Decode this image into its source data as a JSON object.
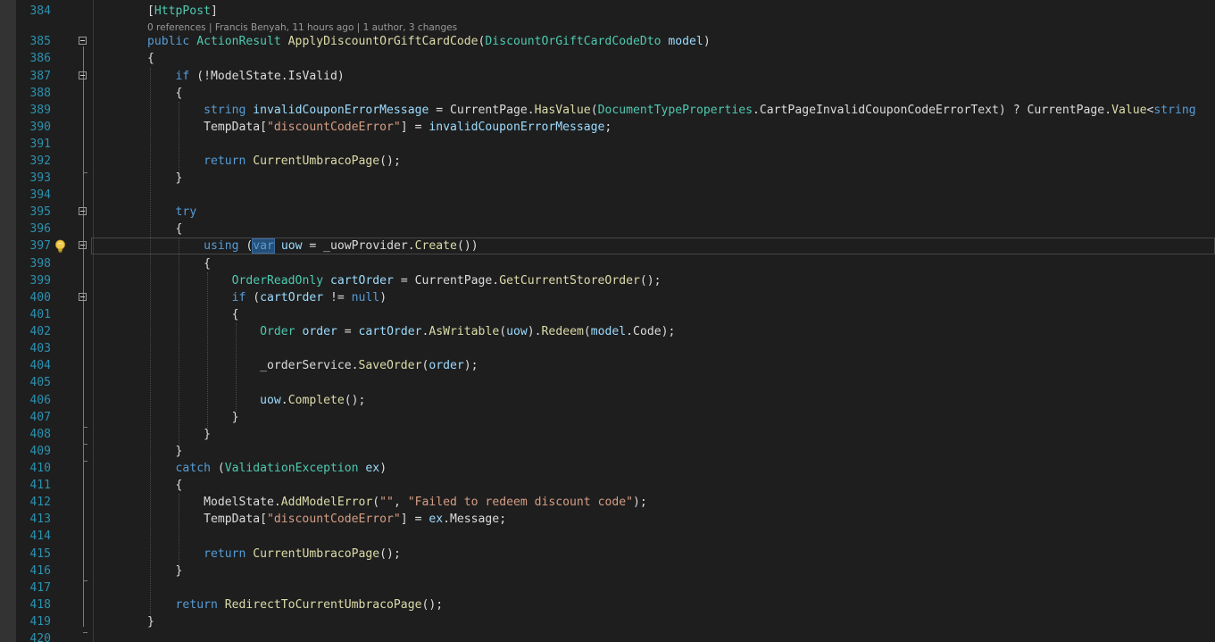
{
  "editor": {
    "codelens": "0 references | Francis Benyah, 11 hours ago | 1 author, 3 changes",
    "lines": [
      {
        "num": "384",
        "tokens": [
          {
            "t": "[",
            "c": "pl"
          },
          {
            "t": "HttpPost",
            "c": "ty"
          },
          {
            "t": "]",
            "c": "pl"
          }
        ]
      },
      {
        "num": "385",
        "tokens": [
          {
            "t": "public ",
            "c": "kw"
          },
          {
            "t": "ActionResult ",
            "c": "ty"
          },
          {
            "t": "ApplyDiscountOrGiftCardCode",
            "c": "fn"
          },
          {
            "t": "(",
            "c": "pl"
          },
          {
            "t": "DiscountOrGiftCardCodeDto ",
            "c": "ty"
          },
          {
            "t": "model",
            "c": "var"
          },
          {
            "t": ")",
            "c": "pl"
          }
        ]
      },
      {
        "num": "386",
        "tokens": [
          {
            "t": "{",
            "c": "pl"
          }
        ]
      },
      {
        "num": "387",
        "tokens": [
          {
            "t": "    ",
            "c": "pl"
          },
          {
            "t": "if ",
            "c": "kw"
          },
          {
            "t": "(!ModelState.IsValid)",
            "c": "pl"
          }
        ]
      },
      {
        "num": "388",
        "tokens": [
          {
            "t": "    {",
            "c": "pl"
          }
        ]
      },
      {
        "num": "389",
        "tokens": [
          {
            "t": "        ",
            "c": "pl"
          },
          {
            "t": "string ",
            "c": "kw"
          },
          {
            "t": "invalidCouponErrorMessage",
            "c": "var"
          },
          {
            "t": " = ",
            "c": "pl"
          },
          {
            "t": "CurrentPage",
            "c": "pl"
          },
          {
            "t": ".",
            "c": "pl"
          },
          {
            "t": "HasValue",
            "c": "fn"
          },
          {
            "t": "(",
            "c": "pl"
          },
          {
            "t": "DocumentTypeProperties",
            "c": "ty"
          },
          {
            "t": ".CartPageInvalidCouponCodeErrorText) ? ",
            "c": "pl"
          },
          {
            "t": "CurrentPage",
            "c": "pl"
          },
          {
            "t": ".",
            "c": "pl"
          },
          {
            "t": "Value",
            "c": "fn"
          },
          {
            "t": "<",
            "c": "pl"
          },
          {
            "t": "string",
            "c": "kw"
          }
        ]
      },
      {
        "num": "390",
        "tokens": [
          {
            "t": "        TempData[",
            "c": "pl"
          },
          {
            "t": "\"discountCodeError\"",
            "c": "str"
          },
          {
            "t": "] = ",
            "c": "pl"
          },
          {
            "t": "invalidCouponErrorMessage",
            "c": "var"
          },
          {
            "t": ";",
            "c": "pl"
          }
        ]
      },
      {
        "num": "391",
        "tokens": []
      },
      {
        "num": "392",
        "tokens": [
          {
            "t": "        ",
            "c": "pl"
          },
          {
            "t": "return ",
            "c": "kw"
          },
          {
            "t": "CurrentUmbracoPage",
            "c": "fn"
          },
          {
            "t": "();",
            "c": "pl"
          }
        ]
      },
      {
        "num": "393",
        "tokens": [
          {
            "t": "    }",
            "c": "pl"
          }
        ]
      },
      {
        "num": "394",
        "tokens": []
      },
      {
        "num": "395",
        "tokens": [
          {
            "t": "    ",
            "c": "pl"
          },
          {
            "t": "try",
            "c": "kw"
          }
        ]
      },
      {
        "num": "396",
        "tokens": [
          {
            "t": "    {",
            "c": "pl"
          }
        ]
      },
      {
        "num": "397",
        "tokens": [
          {
            "t": "        ",
            "c": "pl"
          },
          {
            "t": "using ",
            "c": "kw"
          },
          {
            "t": "(",
            "c": "pl"
          },
          {
            "t": "var",
            "c": "kw sel-var"
          },
          {
            "t": " ",
            "c": "pl"
          },
          {
            "t": "uow",
            "c": "var"
          },
          {
            "t": " = _uowProvider.",
            "c": "pl"
          },
          {
            "t": "Create",
            "c": "fn"
          },
          {
            "t": "())",
            "c": "pl"
          }
        ]
      },
      {
        "num": "398",
        "tokens": [
          {
            "t": "        {",
            "c": "pl"
          }
        ]
      },
      {
        "num": "399",
        "tokens": [
          {
            "t": "            ",
            "c": "pl"
          },
          {
            "t": "OrderReadOnly ",
            "c": "ty"
          },
          {
            "t": "cartOrder",
            "c": "var"
          },
          {
            "t": " = CurrentPage.",
            "c": "pl"
          },
          {
            "t": "GetCurrentStoreOrder",
            "c": "fn"
          },
          {
            "t": "();",
            "c": "pl"
          }
        ]
      },
      {
        "num": "400",
        "tokens": [
          {
            "t": "            ",
            "c": "pl"
          },
          {
            "t": "if ",
            "c": "kw"
          },
          {
            "t": "(",
            "c": "pl"
          },
          {
            "t": "cartOrder",
            "c": "var"
          },
          {
            "t": " != ",
            "c": "pl"
          },
          {
            "t": "null",
            "c": "kw"
          },
          {
            "t": ")",
            "c": "pl"
          }
        ]
      },
      {
        "num": "401",
        "tokens": [
          {
            "t": "            {",
            "c": "pl"
          }
        ]
      },
      {
        "num": "402",
        "tokens": [
          {
            "t": "                ",
            "c": "pl"
          },
          {
            "t": "Order ",
            "c": "ty"
          },
          {
            "t": "order",
            "c": "var"
          },
          {
            "t": " = ",
            "c": "pl"
          },
          {
            "t": "cartOrder",
            "c": "var"
          },
          {
            "t": ".",
            "c": "pl"
          },
          {
            "t": "AsWritable",
            "c": "fn"
          },
          {
            "t": "(",
            "c": "pl"
          },
          {
            "t": "uow",
            "c": "var"
          },
          {
            "t": ").",
            "c": "pl"
          },
          {
            "t": "Redeem",
            "c": "fn"
          },
          {
            "t": "(",
            "c": "pl"
          },
          {
            "t": "model",
            "c": "var"
          },
          {
            "t": ".Code);",
            "c": "pl"
          }
        ]
      },
      {
        "num": "403",
        "tokens": []
      },
      {
        "num": "404",
        "tokens": [
          {
            "t": "                _orderService.",
            "c": "pl"
          },
          {
            "t": "SaveOrder",
            "c": "fn"
          },
          {
            "t": "(",
            "c": "pl"
          },
          {
            "t": "order",
            "c": "var"
          },
          {
            "t": ");",
            "c": "pl"
          }
        ]
      },
      {
        "num": "405",
        "tokens": []
      },
      {
        "num": "406",
        "tokens": [
          {
            "t": "                ",
            "c": "pl"
          },
          {
            "t": "uow",
            "c": "var"
          },
          {
            "t": ".",
            "c": "pl"
          },
          {
            "t": "Complete",
            "c": "fn"
          },
          {
            "t": "();",
            "c": "pl"
          }
        ]
      },
      {
        "num": "407",
        "tokens": [
          {
            "t": "            }",
            "c": "pl"
          }
        ]
      },
      {
        "num": "408",
        "tokens": [
          {
            "t": "        }",
            "c": "pl"
          }
        ]
      },
      {
        "num": "409",
        "tokens": [
          {
            "t": "    }",
            "c": "pl"
          }
        ]
      },
      {
        "num": "410",
        "tokens": [
          {
            "t": "    ",
            "c": "pl"
          },
          {
            "t": "catch ",
            "c": "kw"
          },
          {
            "t": "(",
            "c": "pl"
          },
          {
            "t": "ValidationException ",
            "c": "ty"
          },
          {
            "t": "ex",
            "c": "var"
          },
          {
            "t": ")",
            "c": "pl"
          }
        ]
      },
      {
        "num": "411",
        "tokens": [
          {
            "t": "    {",
            "c": "pl"
          }
        ]
      },
      {
        "num": "412",
        "tokens": [
          {
            "t": "        ModelState.",
            "c": "pl"
          },
          {
            "t": "AddModelError",
            "c": "fn"
          },
          {
            "t": "(",
            "c": "pl"
          },
          {
            "t": "\"\"",
            "c": "str"
          },
          {
            "t": ", ",
            "c": "pl"
          },
          {
            "t": "\"Failed to redeem discount code\"",
            "c": "str"
          },
          {
            "t": ");",
            "c": "pl"
          }
        ]
      },
      {
        "num": "413",
        "tokens": [
          {
            "t": "        TempData[",
            "c": "pl"
          },
          {
            "t": "\"discountCodeError\"",
            "c": "str"
          },
          {
            "t": "] = ",
            "c": "pl"
          },
          {
            "t": "ex",
            "c": "var"
          },
          {
            "t": ".Message;",
            "c": "pl"
          }
        ]
      },
      {
        "num": "414",
        "tokens": []
      },
      {
        "num": "415",
        "tokens": [
          {
            "t": "        ",
            "c": "pl"
          },
          {
            "t": "return ",
            "c": "kw"
          },
          {
            "t": "CurrentUmbracoPage",
            "c": "fn"
          },
          {
            "t": "();",
            "c": "pl"
          }
        ]
      },
      {
        "num": "416",
        "tokens": [
          {
            "t": "    }",
            "c": "pl"
          }
        ]
      },
      {
        "num": "417",
        "tokens": []
      },
      {
        "num": "418",
        "tokens": [
          {
            "t": "    ",
            "c": "pl"
          },
          {
            "t": "return ",
            "c": "kw"
          },
          {
            "t": "RedirectToCurrentUmbracoPage",
            "c": "fn"
          },
          {
            "t": "();",
            "c": "pl"
          }
        ]
      },
      {
        "num": "419",
        "tokens": [
          {
            "t": "}",
            "c": "pl"
          }
        ]
      },
      {
        "num": "420",
        "tokens": []
      }
    ]
  },
  "icons": {
    "lightbulb": "lightbulb-icon",
    "fold": "collapse-icon"
  },
  "colors": {
    "background": "#1e1e1e",
    "line_number": "#2b91af",
    "keyword": "#569cd6",
    "type": "#4ec9b0",
    "method": "#dcdcaa",
    "string": "#d69d85",
    "identifier": "#9cdcfe"
  }
}
